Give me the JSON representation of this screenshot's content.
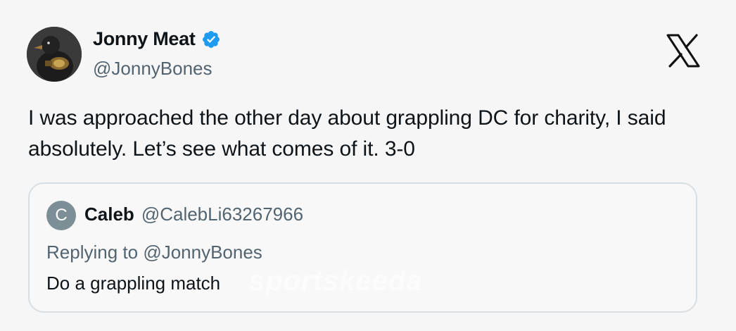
{
  "author": {
    "display_name": "Jonny Meat",
    "handle": "@JonnyBones",
    "verified": true,
    "avatar_icon": "duck-avatar-icon"
  },
  "brand_icon": "x-logo-icon",
  "tweet": {
    "text": "I was approached the other day about grappling DC for charity, I said absolutely. Let’s see what comes of it. 3-0"
  },
  "quoted_tweet": {
    "avatar_initial": "C",
    "display_name": "Caleb",
    "handle": "@CalebLi63267966",
    "replying_prefix": "Replying to",
    "replying_to": "@JonnyBones",
    "text": "Do a grappling match"
  },
  "watermark": "sportskeeda",
  "colors": {
    "verified_badge": "#1d9bf0",
    "secondary_text": "#536471",
    "quote_avatar_bg": "#7d8f96",
    "border": "#d9dee2"
  }
}
